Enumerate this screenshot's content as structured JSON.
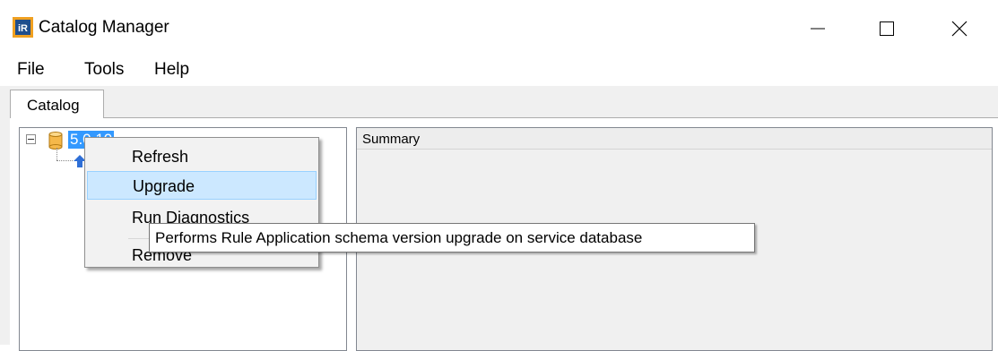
{
  "window": {
    "title": "Catalog Manager",
    "app_icon": "ir-app-icon",
    "controls": [
      "minimize-icon",
      "maximize-icon",
      "close-icon"
    ]
  },
  "menubar": {
    "items": [
      {
        "label": "File"
      },
      {
        "label": "Tools"
      },
      {
        "label": "Help"
      }
    ]
  },
  "tabs": [
    {
      "label": "Catalog",
      "active": true
    }
  ],
  "tree": {
    "root": {
      "label": "5.0.10",
      "icon": "database-icon",
      "expanded": true,
      "selected": true
    },
    "children": [
      {
        "icon": "upgrade-arrow-icon"
      }
    ]
  },
  "summary": {
    "header": "Summary"
  },
  "context_menu": {
    "items": [
      {
        "label": "Refresh",
        "highlighted": false
      },
      {
        "label": "Upgrade",
        "highlighted": true
      },
      {
        "label": "Run Diagnostics",
        "highlighted": false
      },
      {
        "label": "Remove",
        "highlighted": false
      }
    ]
  },
  "tooltip": {
    "text": "Performs Rule Application schema version upgrade on service database"
  },
  "colors": {
    "selection": "#3399ff",
    "menu_highlight": "#cce8ff",
    "menu_highlight_border": "#99d1ff"
  }
}
